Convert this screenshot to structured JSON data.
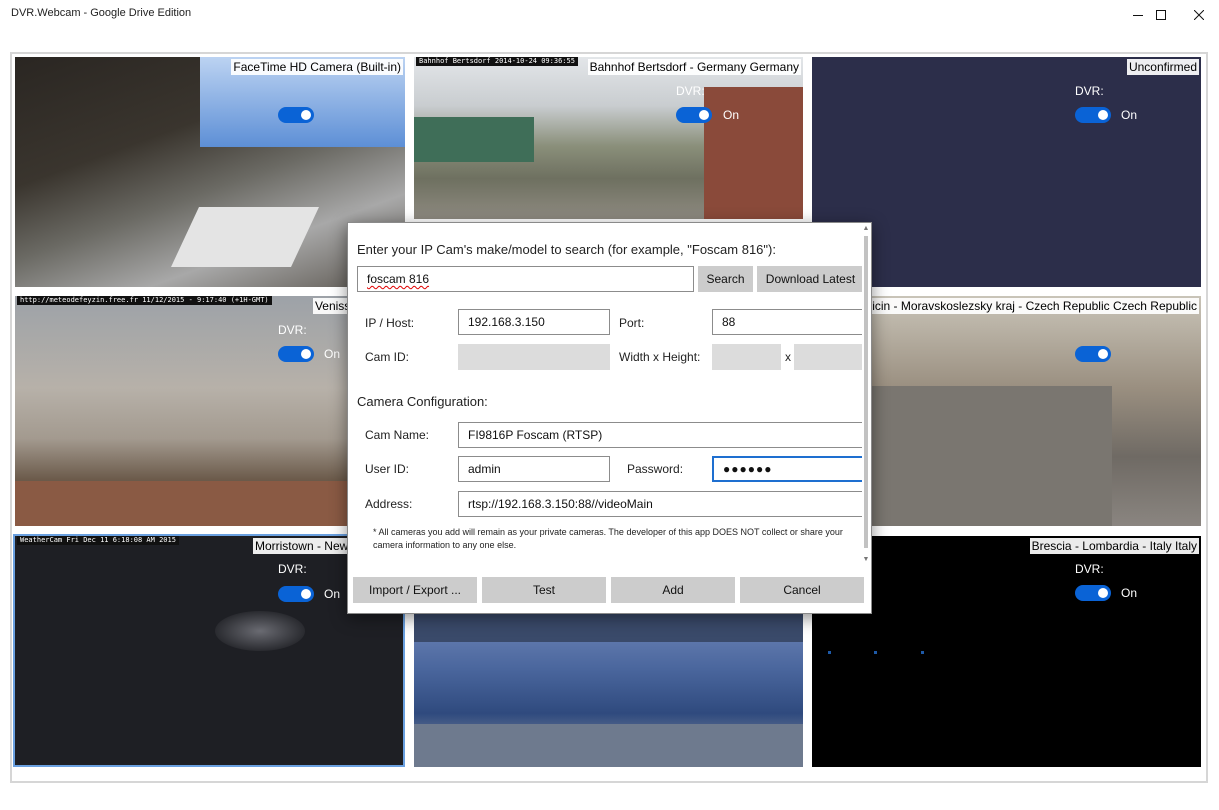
{
  "window": {
    "title": "DVR.Webcam - Google Drive Edition",
    "minimize_icon": "minimize-icon",
    "maximize_icon": "maximize-icon",
    "close_icon": "close-icon"
  },
  "cameras": [
    {
      "label": "FaceTime HD Camera (Built-in)",
      "stamp": "",
      "dvr_label": "",
      "toggle_text": ""
    },
    {
      "label": "Bahnhof Bertsdorf - Germany Germany",
      "stamp": "Bahnhof Bertsdorf 2014-10-24 09:36:55",
      "dvr_label": "DVR:",
      "toggle_text": "On"
    },
    {
      "label": "Unconfirmed",
      "stamp": "",
      "dvr_label": "DVR:",
      "toggle_text": "On"
    },
    {
      "label": "Venissieux - Fra",
      "stamp": "http://meteodefeyzin.free.fr  11/12/2015 - 9:17:40 (+1H-GMT)",
      "dvr_label": "DVR:",
      "toggle_text": "On"
    },
    {
      "label": "Novy Jicin - Moravskoslezsky kraj - Czech Republic Czech Republic",
      "stamp": "",
      "dvr_label": "",
      "toggle_text": ""
    },
    {
      "label": "Morristown - New Jersey U",
      "stamp": "WeatherCam  Fri Dec 11  6:18:08 AM 2015",
      "dvr_label": "DVR:",
      "toggle_text": "On"
    },
    {
      "label": "",
      "stamp": "",
      "dvr_label": "",
      "toggle_text": ""
    },
    {
      "label": "Brescia - Lombardia - Italy Italy",
      "stamp": "",
      "dvr_label": "DVR:",
      "toggle_text": "On"
    }
  ],
  "dialog": {
    "prompt": "Enter your IP Cam's make/model to search (for example, \"Foscam 816\"):",
    "search_value": "foscam 816",
    "search_button": "Search",
    "download_button": "Download Latest",
    "ip_label": "IP / Host:",
    "ip_value": "192.168.3.150",
    "port_label": "Port:",
    "port_value": "88",
    "camid_label": "Cam ID:",
    "camid_value": "",
    "wh_label": "Width x Height:",
    "width_value": "",
    "x_label": "x",
    "height_value": "",
    "config_heading": "Camera Configuration:",
    "camname_label": "Cam Name:",
    "camname_value": "FI9816P Foscam (RTSP)",
    "userid_label": "User ID:",
    "userid_value": "admin",
    "password_label": "Password:",
    "password_value": "●●●●●●",
    "address_label": "Address:",
    "address_value": "rtsp://192.168.3.150:88//videoMain",
    "note": "* All cameras you add will remain as your private cameras.  The developer of this app DOES NOT collect or share your camera information to any one else.",
    "import_button": "Import / Export ...",
    "test_button": "Test",
    "add_button": "Add",
    "cancel_button": "Cancel"
  },
  "colors": {
    "toggle_on": "#0a63d6",
    "focus_border": "#1e6fd0",
    "button_bg": "#cccccc",
    "disabled_input": "#dcdcdc"
  }
}
